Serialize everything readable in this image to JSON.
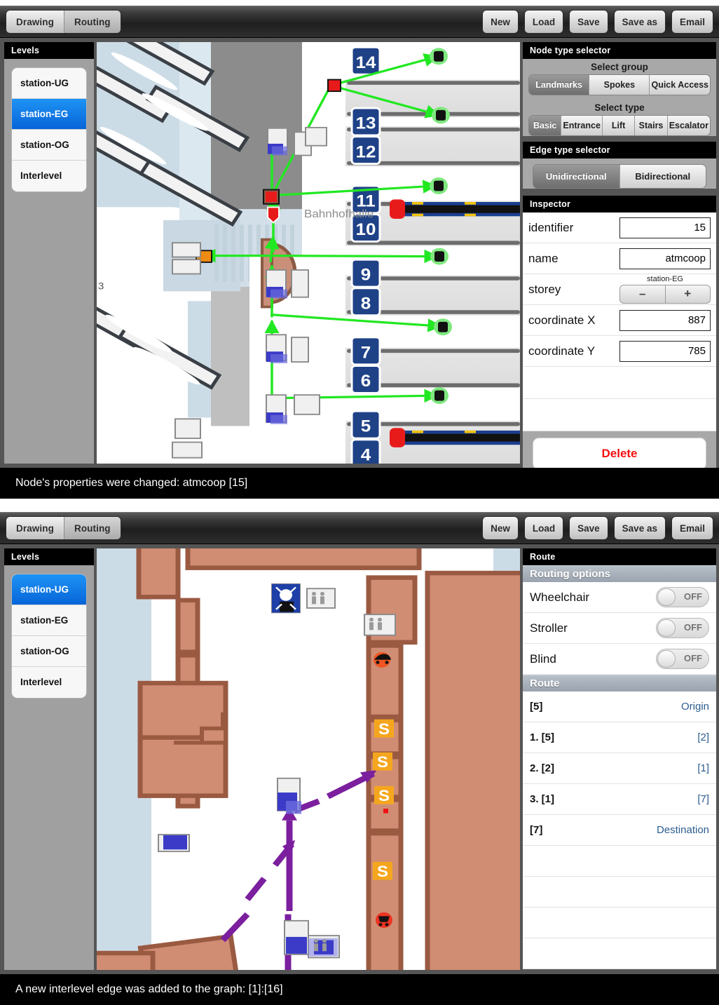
{
  "top": {
    "toolbar": {
      "tabs": [
        {
          "label": "Drawing",
          "selected": false
        },
        {
          "label": "Routing",
          "selected": true
        }
      ],
      "buttons": [
        "New",
        "Load",
        "Save",
        "Save as",
        "Email"
      ]
    },
    "levels": {
      "header": "Levels",
      "items": [
        {
          "label": "station-UG",
          "selected": false
        },
        {
          "label": "station-EG",
          "selected": true
        },
        {
          "label": "station-OG",
          "selected": false
        },
        {
          "label": "Interlevel",
          "selected": false
        }
      ]
    },
    "node_type_selector": {
      "header": "Node type selector",
      "group_label": "Select group",
      "groups": [
        {
          "label": "Landmarks",
          "selected": true
        },
        {
          "label": "Spokes",
          "selected": false
        },
        {
          "label": "Quick Access",
          "selected": false
        }
      ],
      "type_label": "Select type",
      "types": [
        {
          "label": "Basic",
          "selected": true
        },
        {
          "label": "Entrance",
          "selected": false
        },
        {
          "label": "Lift",
          "selected": false
        },
        {
          "label": "Stairs",
          "selected": false
        },
        {
          "label": "Escalator",
          "selected": false
        }
      ]
    },
    "edge_type_selector": {
      "header": "Edge type selector",
      "options": [
        {
          "label": "Unidirectional",
          "selected": true
        },
        {
          "label": "Bidirectional",
          "selected": false
        }
      ]
    },
    "inspector": {
      "header": "Inspector",
      "rows": [
        {
          "label": "identifier",
          "value": "15"
        },
        {
          "label": "name",
          "value": "atmcoop"
        },
        {
          "label": "coordinate X",
          "value": "887"
        },
        {
          "label": "coordinate Y",
          "value": "785"
        }
      ],
      "storey": {
        "label": "storey",
        "value": "station-EG",
        "minus": "–",
        "plus": "+"
      },
      "delete_label": "Delete"
    },
    "map": {
      "area_label": "Bahnhofhalle",
      "edge_label": "3",
      "platform_numbers": [
        "14",
        "13",
        "12",
        "11",
        "10",
        "9",
        "8",
        "7",
        "6",
        "5",
        "4"
      ]
    },
    "status": "Node's properties were changed: atmcoop [15]"
  },
  "bottom": {
    "toolbar": {
      "tabs": [
        {
          "label": "Drawing",
          "selected": false
        },
        {
          "label": "Routing",
          "selected": true
        }
      ],
      "buttons": [
        "New",
        "Load",
        "Save",
        "Save as",
        "Email"
      ]
    },
    "levels": {
      "header": "Levels",
      "items": [
        {
          "label": "station-UG",
          "selected": true
        },
        {
          "label": "station-EG",
          "selected": false
        },
        {
          "label": "station-OG",
          "selected": false
        },
        {
          "label": "Interlevel",
          "selected": false
        }
      ]
    },
    "route_panel": {
      "header": "Route",
      "options_header": "Routing options",
      "options": [
        {
          "label": "Wheelchair",
          "state": "OFF"
        },
        {
          "label": "Stroller",
          "state": "OFF"
        },
        {
          "label": "Blind",
          "state": "OFF"
        }
      ],
      "route_header": "Route",
      "steps": [
        {
          "left": "[5]",
          "right": "Origin"
        },
        {
          "left": "1. [5]",
          "right": "[2]"
        },
        {
          "left": "2. [2]",
          "right": "[1]"
        },
        {
          "left": "3. [1]",
          "right": "[7]"
        },
        {
          "left": "[7]",
          "right": "Destination"
        }
      ]
    },
    "map": {
      "shop_markers": [
        "S",
        "S",
        "S",
        "S"
      ]
    },
    "status": "A new interlevel edge was added to the graph: [1]:[16]"
  },
  "colors": {
    "accent_blue": "#0f78e8",
    "delete_red": "#f50f0f",
    "route_purple": "#7b1f9e",
    "edge_green": "#22e822",
    "building_tan": "#d08d74",
    "water_blue": "#ccdce6"
  }
}
